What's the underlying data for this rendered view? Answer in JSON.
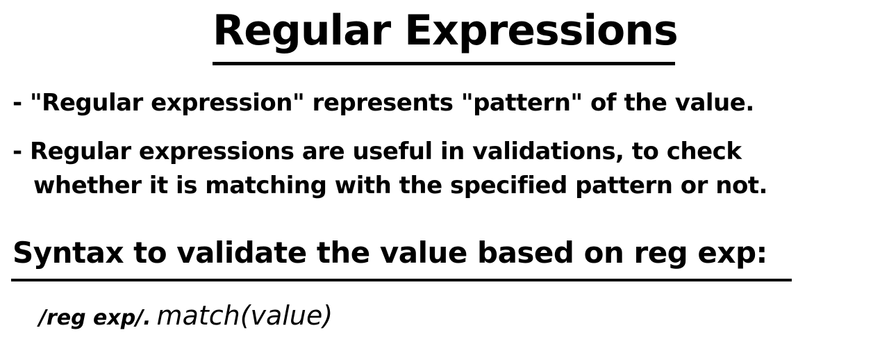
{
  "slide": {
    "title": "Regular Expressions",
    "bullets": [
      "- \"Regular expression\" represents \"pattern\" of the value.",
      "- Regular expressions are useful in validations, to check",
      "whether it is matching with the specified pattern or not."
    ],
    "subheading": "Syntax to validate the value based on reg exp:",
    "syntax": {
      "regexp_part": "/reg exp/.",
      "method_part": "match(value)"
    }
  }
}
